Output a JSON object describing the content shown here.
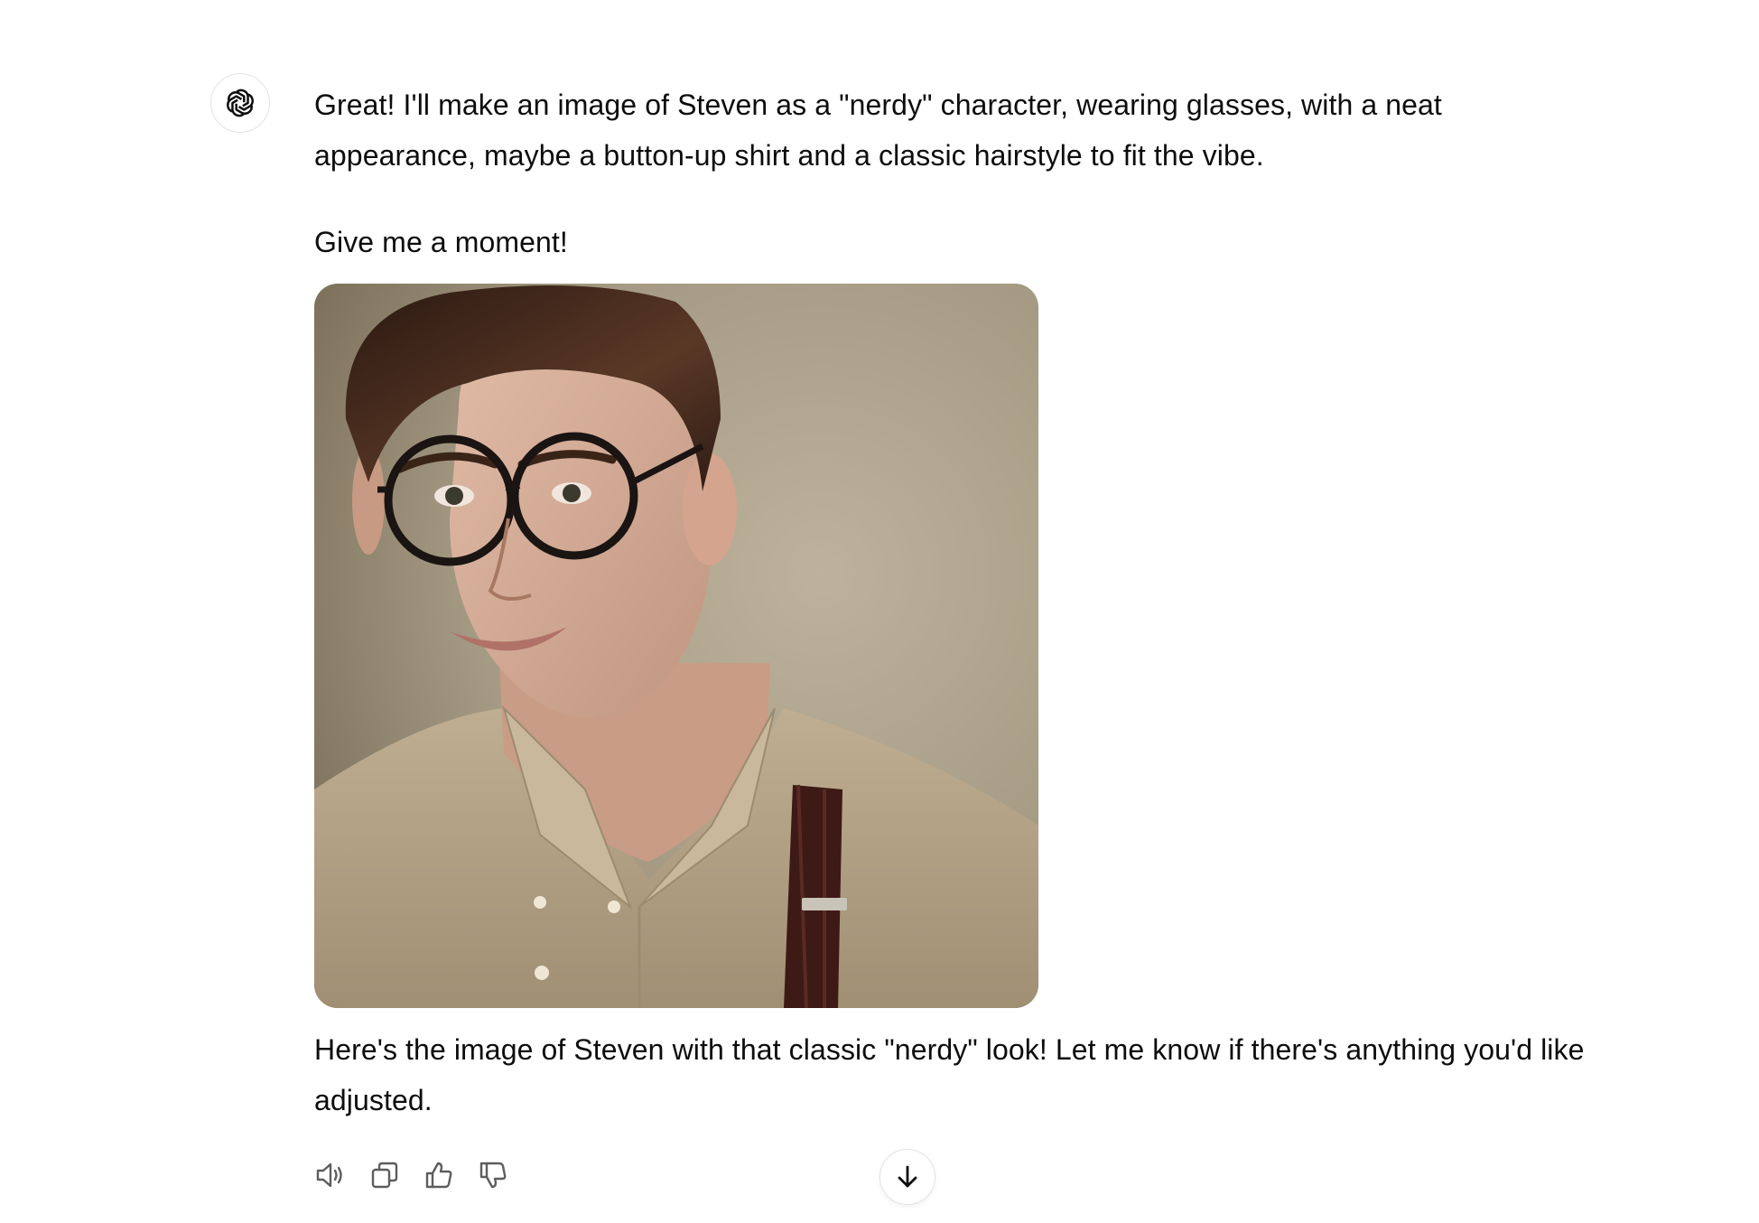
{
  "assistant": {
    "avatar_icon": "openai-logo-icon"
  },
  "message": {
    "intro": "Great! I'll make an image of Steven as a \"nerdy\" character, wearing glasses, with a neat appearance, maybe a button-up shirt and a classic hairstyle to fit the vibe.",
    "moment": "Give me a moment!",
    "image_icon": "generated-portrait-image",
    "followup": "Here's the image of Steven with that classic \"nerdy\" look! Let me know if there's anything you'd like adjusted."
  },
  "actions": [
    {
      "icon": "speaker-icon"
    },
    {
      "icon": "copy-icon"
    },
    {
      "icon": "thumbs-up-icon"
    },
    {
      "icon": "thumbs-down-icon"
    }
  ],
  "scroll_button": {
    "icon": "arrow-down-icon"
  },
  "colors": {
    "text": "#0d0d0d",
    "border": "#e3e3e3",
    "icon": "#5d5d5d",
    "image_background": "#a59a83",
    "hair": "#3a2418",
    "shirt": "#b7a78b",
    "skin": "#d8b19c",
    "suspender": "#3d1a16"
  }
}
